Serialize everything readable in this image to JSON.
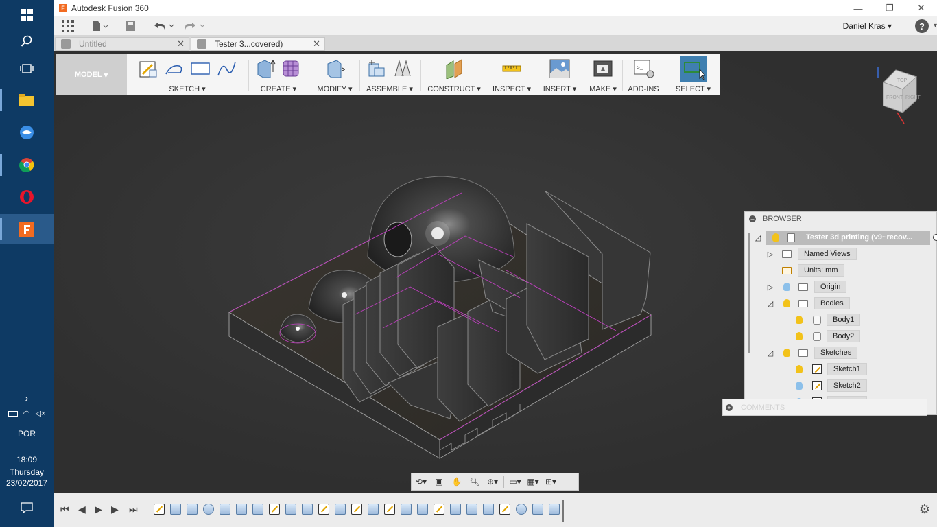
{
  "window": {
    "title": "Autodesk Fusion 360"
  },
  "appbar": {
    "user": "Daniel Kras"
  },
  "tabs": [
    {
      "label": "Untitled",
      "active": false
    },
    {
      "label": "Tester 3...covered)",
      "active": true
    }
  ],
  "toolbar": {
    "workspace": "MODEL",
    "groups": [
      {
        "label": "SKETCH"
      },
      {
        "label": "CREATE"
      },
      {
        "label": "MODIFY"
      },
      {
        "label": "ASSEMBLE"
      },
      {
        "label": "CONSTRUCT"
      },
      {
        "label": "INSPECT"
      },
      {
        "label": "INSERT"
      },
      {
        "label": "MAKE"
      },
      {
        "label": "ADD-INS"
      },
      {
        "label": "SELECT"
      }
    ]
  },
  "viewcube": {
    "faces": [
      "TOP",
      "FRONT",
      "RIGHT"
    ]
  },
  "browser": {
    "title": "BROWSER",
    "root": "Tester 3d printing (v9~recov...",
    "items": [
      {
        "label": "Named Views",
        "icon": "folder-icon"
      },
      {
        "label": "Units: mm",
        "icon": "units-icon"
      },
      {
        "label": "Origin",
        "icon": "folder-icon"
      },
      {
        "label": "Bodies",
        "icon": "folder-icon"
      },
      {
        "label": "Body1",
        "icon": "body-icon"
      },
      {
        "label": "Body2",
        "icon": "body-icon"
      },
      {
        "label": "Sketches",
        "icon": "folder-icon"
      },
      {
        "label": "Sketch1",
        "icon": "sketch-icon"
      },
      {
        "label": "Sketch2",
        "icon": "sketch-icon"
      },
      {
        "label": "Sketch3",
        "icon": "sketch-icon"
      }
    ]
  },
  "comments": {
    "label": "COMMENTS"
  },
  "taskbar": {
    "language": "POR",
    "time": "18:09",
    "day": "Thursday",
    "date": "23/02/2017"
  },
  "colors": {
    "accent": "#f26b21",
    "taskbar": "#0e3a64",
    "select_active": "#3f7fb0"
  }
}
